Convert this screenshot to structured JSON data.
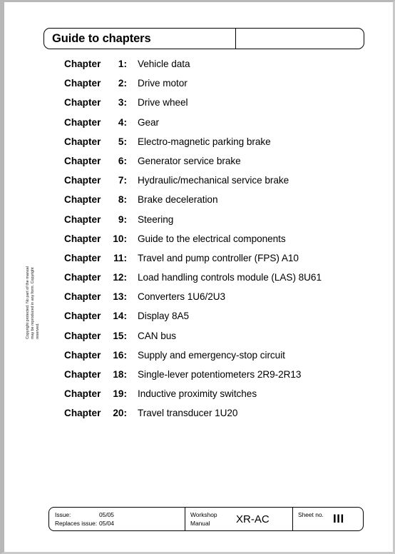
{
  "header": {
    "title": "Guide to chapters",
    "field_value": ""
  },
  "chapters": {
    "label": "Chapter",
    "items": [
      {
        "number": "1:",
        "title": "Vehicle data"
      },
      {
        "number": "2:",
        "title": "Drive motor"
      },
      {
        "number": "3:",
        "title": "Drive wheel"
      },
      {
        "number": "4:",
        "title": "Gear"
      },
      {
        "number": "5:",
        "title": "Electro-magnetic parking brake"
      },
      {
        "number": "6:",
        "title": "Generator service brake"
      },
      {
        "number": "7:",
        "title": "Hydraulic/mechanical service brake"
      },
      {
        "number": "8:",
        "title": "Brake deceleration"
      },
      {
        "number": "9:",
        "title": "Steering"
      },
      {
        "number": "10:",
        "title": "Guide to the electrical components"
      },
      {
        "number": "11:",
        "title": "Travel and pump controller (FPS) A10"
      },
      {
        "number": "12:",
        "title": "Load handling controls module (LAS) 8U61"
      },
      {
        "number": "13:",
        "title": "Converters 1U6/2U3"
      },
      {
        "number": "14:",
        "title": "Display 8A5"
      },
      {
        "number": "15:",
        "title": "CAN bus"
      },
      {
        "number": "16:",
        "title": "Supply and emergency-stop circuit"
      },
      {
        "number": "18:",
        "title": "Single-lever potentiometers 2R9-2R13"
      },
      {
        "number": "19:",
        "title": "Inductive proximity switches"
      },
      {
        "number": "20:",
        "title": "Travel transducer 1U20"
      }
    ]
  },
  "copyright": {
    "line1": "Copyright protected. No part of the manual",
    "line2": "may be reproduced in any form. Copyright",
    "line3": "reserved."
  },
  "footer": {
    "issue_label": "Issue:",
    "issue_value": "05/05",
    "replaces_label": "Replaces issue:",
    "replaces_value": "05/04",
    "manual_line1": "Workshop",
    "manual_line2": "Manual",
    "model": "XR-AC",
    "sheet_label": "Sheet no.",
    "sheet_value": "III"
  }
}
